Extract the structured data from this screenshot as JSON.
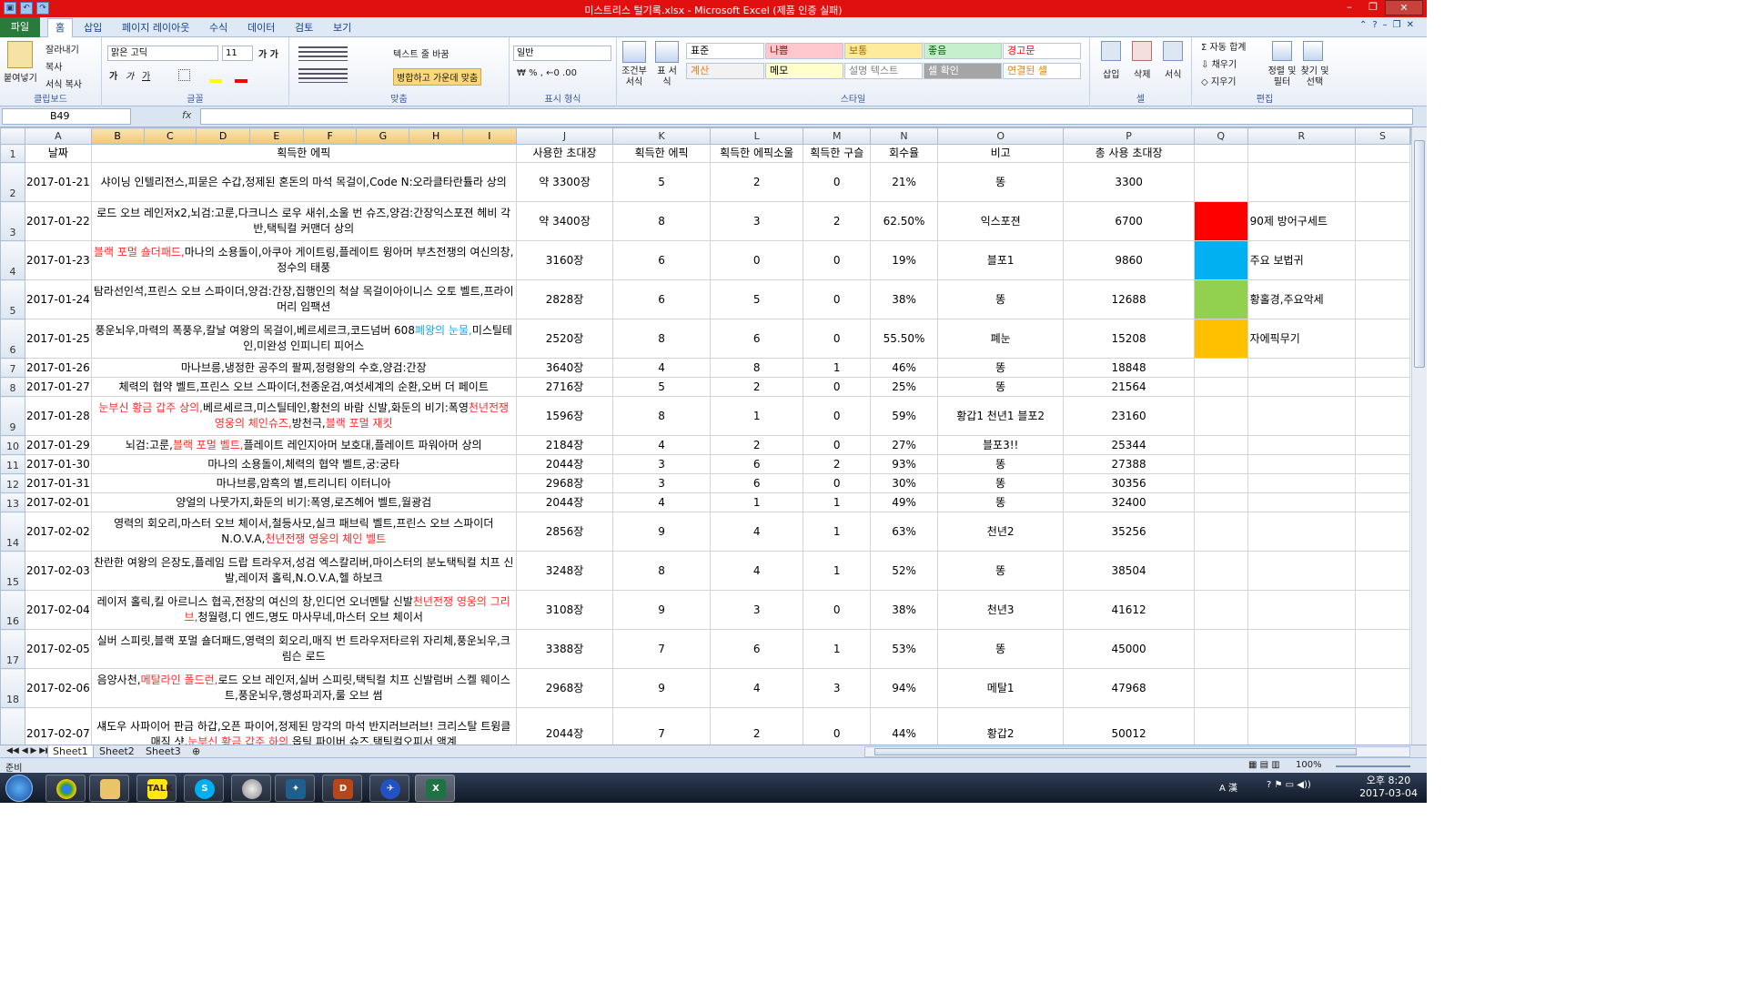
{
  "titlebar": {
    "title": "미스트리스 털기록.xlsx  -  Microsoft Excel (제품 인증 실패)"
  },
  "tabs": [
    "파일",
    "홈",
    "삽입",
    "페이지 레이아웃",
    "수식",
    "데이터",
    "검토",
    "보기"
  ],
  "ribbon": {
    "clipboard": {
      "paste": "붙여넣기",
      "cut": "잘라내기",
      "copy": "복사",
      "format_painter": "서식 복사",
      "label": "클립보드"
    },
    "font": {
      "name": "맑은 고딕",
      "size": "11",
      "label": "글꼴"
    },
    "alignment": {
      "wrap": "텍스트 줄 바꿈",
      "merge": "병합하고 가운데 맞춤",
      "label": "맞춤"
    },
    "number": {
      "format": "일반",
      "label": "표시 형식"
    },
    "styles": {
      "conditional": "조건부 서식",
      "table": "표 서식",
      "label": "스타일",
      "cells": [
        {
          "text": "표준",
          "bg": "#ffffff",
          "color": "#000000"
        },
        {
          "text": "나쁨",
          "bg": "#ffc7ce",
          "color": "#9c0006"
        },
        {
          "text": "보통",
          "bg": "#ffeb9c",
          "color": "#9c6500"
        },
        {
          "text": "좋음",
          "bg": "#c6efce",
          "color": "#006100"
        },
        {
          "text": "경고문",
          "bg": "#ffffff",
          "color": "#ff0000"
        },
        {
          "text": "계산",
          "bg": "#f2f2f2",
          "color": "#fa7d00"
        },
        {
          "text": "메모",
          "bg": "#ffffcc",
          "color": "#000000"
        },
        {
          "text": "설명 텍스트",
          "bg": "#ffffff",
          "color": "#7f7f7f"
        },
        {
          "text": "셀 확인",
          "bg": "#a5a5a5",
          "color": "#ffffff"
        },
        {
          "text": "연결된 셀",
          "bg": "#ffffff",
          "color": "#fa7d00"
        }
      ]
    },
    "cells": {
      "insert": "삽입",
      "delete": "삭제",
      "format": "서식",
      "label": "셀"
    },
    "editing": {
      "autosum": "자동 합계",
      "fill": "채우기",
      "clear": "지우기",
      "sort": "정렬 및 필터",
      "find": "찾기 및 선택",
      "label": "편집"
    }
  },
  "formula_bar": {
    "name_box": "B49",
    "fx": "fx",
    "value": ""
  },
  "columns": [
    "A",
    "B",
    "C",
    "D",
    "E",
    "F",
    "G",
    "H",
    "I",
    "J",
    "K",
    "L",
    "M",
    "N",
    "O",
    "P",
    "Q",
    "R",
    "S"
  ],
  "header_row": {
    "num": "1",
    "date": "날짜",
    "loot": "획득한 에픽",
    "used": "사용한 초대장",
    "epic": "획득한 에픽",
    "consumable": "획득한 에픽소울",
    "bead": "획득한 구슬",
    "rate": "회수율",
    "note": "비고",
    "total": "총 사용 초대장"
  },
  "rows": [
    {
      "num": "2",
      "date": "2017-01-21",
      "loot": [
        [
          "샤이닝 인텔리전스,피묻은 수갑,정제된 혼돈의 마석 목걸이,Code N:오라클",
          ""
        ],
        [
          "타란튤라 상의",
          ""
        ]
      ],
      "used": "약 3300장",
      "epic": "5",
      "consumable": "2",
      "bead": "0",
      "rate": "21%",
      "note": "똥",
      "total": "3300"
    },
    {
      "num": "3",
      "date": "2017-01-22",
      "loot": [
        [
          "로드 오브 레인저x2,뇌검:고룬,다크니스 로우 새쉬,소울 번 슈즈,양검:간장",
          ""
        ],
        [
          "익스포젼 헤비 각반,택틱컬 커맨더 상의",
          ""
        ]
      ],
      "used": "약 3400장",
      "epic": "8",
      "consumable": "3",
      "bead": "2",
      "rate": "62.50%",
      "note": "익스포젼",
      "total": "6700",
      "legend_color": "#ff0000",
      "legend": "90제 방어구세트"
    },
    {
      "num": "4",
      "date": "2017-01-23",
      "loot": [
        [
          "블랙 포멀 숄더패드,",
          "red"
        ],
        [
          "마나의 소용돌이,아쿠아 게이트링,플레이트 윙아머 부츠",
          ""
        ],
        [
          "전쟁의 여신의창,정수의 태풍",
          ""
        ]
      ],
      "used": "3160장",
      "epic": "6",
      "consumable": "0",
      "bead": "0",
      "rate": "19%",
      "note": "블포1",
      "total": "9860",
      "legend_color": "#00b0f0",
      "legend": "주요 보법귀"
    },
    {
      "num": "5",
      "date": "2017-01-24",
      "loot": [
        [
          "탐라선인석,프린스 오브 스파이더,양검:간장,집행인의 척살 목걸이",
          ""
        ],
        [
          "아이니스 오토 벨트,프라이머리 임팩션",
          ""
        ]
      ],
      "used": "2828장",
      "epic": "6",
      "consumable": "5",
      "bead": "0",
      "rate": "38%",
      "note": "똥",
      "total": "12688",
      "legend_color": "#92d050",
      "legend": "황홀경,주요악세"
    },
    {
      "num": "6",
      "date": "2017-01-25",
      "loot": [
        [
          "풍운뇌우,마력의 폭풍우,칼날 여왕의 목걸이,베르세르크,코드넘버 608",
          ""
        ],
        [
          "폐왕의 눈물,",
          "blue"
        ],
        [
          "미스틸테인,미완성 인피니티 피어스",
          ""
        ]
      ],
      "used": "2520장",
      "epic": "8",
      "consumable": "6",
      "bead": "0",
      "rate": "55.50%",
      "note": "폐눈",
      "total": "15208",
      "legend_color": "#ffc000",
      "legend": "자에픽무기"
    },
    {
      "num": "7",
      "date": "2017-01-26",
      "loot": [
        [
          "마나브릉,냉정한 공주의 팔찌,정령왕의 수호,양검:간장",
          ""
        ]
      ],
      "used": "3640장",
      "epic": "4",
      "consumable": "8",
      "bead": "1",
      "rate": "46%",
      "note": "똥",
      "total": "18848"
    },
    {
      "num": "8",
      "date": "2017-01-27",
      "loot": [
        [
          "체력의 협약 벨트,프린스 오브 스파이더,천종운검,여섯세계의 순환,오버 더 페이트",
          ""
        ]
      ],
      "used": "2716장",
      "epic": "5",
      "consumable": "2",
      "bead": "0",
      "rate": "25%",
      "note": "똥",
      "total": "21564"
    },
    {
      "num": "9",
      "date": "2017-01-28",
      "loot": [
        [
          "눈부신 황금 갑주 상의,",
          "red"
        ],
        [
          "베르세르크,미스틸테인,황천의 바람 신발,화둔의 비기:폭영",
          ""
        ],
        [
          "천년전쟁 영웅의 체인슈즈,",
          "red"
        ],
        [
          "방천극,",
          ""
        ],
        [
          "블랙 포멀 재킷",
          "red"
        ]
      ],
      "used": "1596장",
      "epic": "8",
      "consumable": "1",
      "bead": "0",
      "rate": "59%",
      "note": "황갑1 천년1 블포2",
      "total": "23160"
    },
    {
      "num": "10",
      "date": "2017-01-29",
      "loot": [
        [
          "뇌검:고룬,",
          ""
        ],
        [
          "블랙 포멀 벨트,",
          "red"
        ],
        [
          "플레이트 레인지아머 보호대,플레이트 파워아머 상의",
          ""
        ]
      ],
      "used": "2184장",
      "epic": "4",
      "consumable": "2",
      "bead": "0",
      "rate": "27%",
      "note": "블포3!!",
      "total": "25344"
    },
    {
      "num": "11",
      "date": "2017-01-30",
      "loot": [
        [
          "마나의 소용돌이,체력의 협약 벨트,궁:궁타",
          ""
        ]
      ],
      "used": "2044장",
      "epic": "3",
      "consumable": "6",
      "bead": "2",
      "rate": "93%",
      "note": "똥",
      "total": "27388"
    },
    {
      "num": "12",
      "date": "2017-01-31",
      "loot": [
        [
          "마나브릉,암흑의 별,트리니티 이터니아",
          ""
        ]
      ],
      "used": "2968장",
      "epic": "3",
      "consumable": "6",
      "bead": "0",
      "rate": "30%",
      "note": "똥",
      "total": "30356"
    },
    {
      "num": "13",
      "date": "2017-02-01",
      "loot": [
        [
          "양얼의 나뭇가지,화둔의 비기:폭영,로즈헤어 벨트,월광검",
          ""
        ]
      ],
      "used": "2044장",
      "epic": "4",
      "consumable": "1",
      "bead": "1",
      "rate": "49%",
      "note": "똥",
      "total": "32400"
    },
    {
      "num": "14",
      "date": "2017-02-02",
      "loot": [
        [
          "영력의 회오리,마스터 오브 체이서,철등사모,실크 패브릭 벨트,프린스 오브 스파이더",
          ""
        ],
        [
          "N.O.V.A,",
          ""
        ],
        [
          "천년전쟁 영웅의 체인 벨트",
          "red"
        ]
      ],
      "used": "2856장",
      "epic": "9",
      "consumable": "4",
      "bead": "1",
      "rate": "63%",
      "note": "천년2",
      "total": "35256"
    },
    {
      "num": "15",
      "date": "2017-02-03",
      "loot": [
        [
          "찬란한 여왕의 은장도,플레임 드랍 트라우저,성검 엑스칼리버,마이스터의 분노",
          ""
        ],
        [
          "택틱컬 치프 신발,레이저 홀릭,N.O.V.A,헬 하보크",
          ""
        ]
      ],
      "used": "3248장",
      "epic": "8",
      "consumable": "4",
      "bead": "1",
      "rate": "52%",
      "note": "똥",
      "total": "38504"
    },
    {
      "num": "16",
      "date": "2017-02-04",
      "loot": [
        [
          "레이저 홀릭,킬 아르니스 협곡,전장의 여신의 창,인디언 오너멘탈 신발",
          ""
        ],
        [
          "천년전쟁 영웅의 그리브,",
          "red"
        ],
        [
          "청월령,디 엔드,명도 마사무네,마스터 오브 체이서",
          ""
        ]
      ],
      "used": "3108장",
      "epic": "9",
      "consumable": "3",
      "bead": "0",
      "rate": "38%",
      "note": "천년3",
      "total": "41612"
    },
    {
      "num": "17",
      "date": "2017-02-05",
      "loot": [
        [
          "실버 스피릿,블랙 포멀 숄더패드,영력의 회오리,매직 번 트라우저",
          ""
        ],
        [
          "타르위 자리체,풍운뇌우,크림슨 로드",
          ""
        ]
      ],
      "used": "3388장",
      "epic": "7",
      "consumable": "6",
      "bead": "1",
      "rate": "53%",
      "note": "똥",
      "total": "45000"
    },
    {
      "num": "18",
      "date": "2017-02-06",
      "loot": [
        [
          "음양사천,",
          ""
        ],
        [
          "메탈라인 폴드런,",
          "red"
        ],
        [
          "로드 오브 레인저,실버 스피릿,택틱컬 치프 신발",
          ""
        ],
        [
          "럼버 스켈 웨이스트,풍운뇌우,행성파괴자,룰 오브 썸",
          ""
        ]
      ],
      "used": "2968장",
      "epic": "9",
      "consumable": "4",
      "bead": "3",
      "rate": "94%",
      "note": "메탈1",
      "total": "47968"
    },
    {
      "num": "19",
      "date": "2017-02-07",
      "loot": [
        [
          "섀도우 사파이어 판금 하갑,오픈 파이어,정제된 망각의 마석 반지",
          ""
        ],
        [
          "러브러브! 크리스탈 트윙클 매직 샷,",
          ""
        ],
        [
          "눈부신 황금 갑주 하의,",
          "red"
        ],
        [
          "옵틱 파이버 슈즈,택틱컬",
          ""
        ],
        [
          "오피서 액계",
          ""
        ]
      ],
      "used": "2044장",
      "epic": "7",
      "consumable": "2",
      "bead": "0",
      "rate": "44%",
      "note": "황갑2",
      "total": "50012"
    }
  ],
  "sheets": [
    "Sheet1",
    "Sheet2",
    "Sheet3"
  ],
  "status": {
    "ready": "준비",
    "zoom": "100%"
  },
  "tray": {
    "ime": "A 漢",
    "time": "오후 8:20",
    "date": "2017-03-04"
  }
}
